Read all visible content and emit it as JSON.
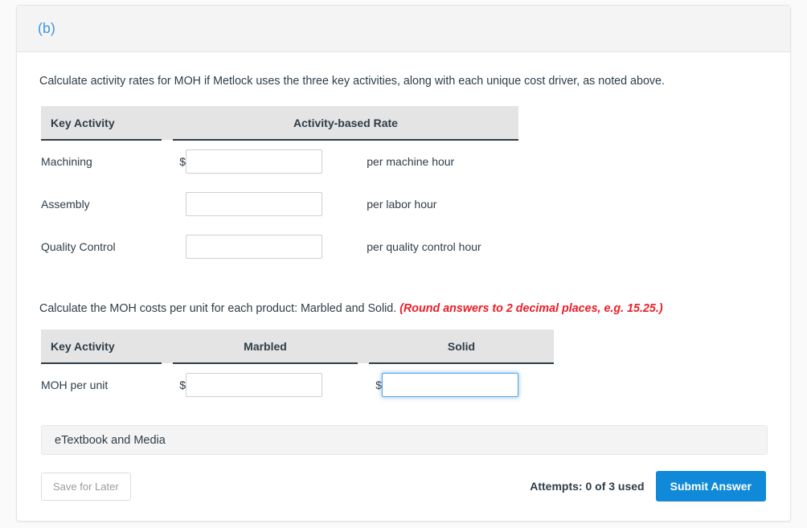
{
  "card": {
    "part_label": "(b)"
  },
  "prompts": {
    "first": "Calculate activity rates for MOH if Metlock uses the three key activities, along with each unique cost driver, as noted above.",
    "second": "Calculate the MOH costs per unit for each product: Marbled and Solid.",
    "round_note": "(Round answers to 2 decimal places, e.g. 15.25.)"
  },
  "rate_table": {
    "headers": [
      "Key Activity",
      "Activity-based Rate"
    ],
    "rows": [
      {
        "activity": "Machining",
        "currency": "$",
        "value": "",
        "unit": "per machine hour"
      },
      {
        "activity": "Assembly",
        "currency": "",
        "value": "",
        "unit": "per labor hour"
      },
      {
        "activity": "Quality Control",
        "currency": "",
        "value": "",
        "unit": "per quality control hour"
      }
    ]
  },
  "moh_table": {
    "headers": [
      "Key Activity",
      "Marbled",
      "Solid"
    ],
    "rows": [
      {
        "activity": "MOH per unit",
        "marbled_currency": "$",
        "marbled_value": "",
        "solid_currency": "$",
        "solid_value": ""
      }
    ]
  },
  "etextbook": {
    "label": "eTextbook and Media"
  },
  "footer": {
    "save_label": "Save for Later",
    "attempts": "Attempts: 0 of 3 used",
    "submit_label": "Submit Answer"
  },
  "colors": {
    "accent_blue": "#1089d9",
    "part_label_blue": "#3a94e0",
    "note_red": "#ee1c25",
    "header_gray": "#e4e4e4",
    "focus_blue": "#5ba4e0"
  }
}
